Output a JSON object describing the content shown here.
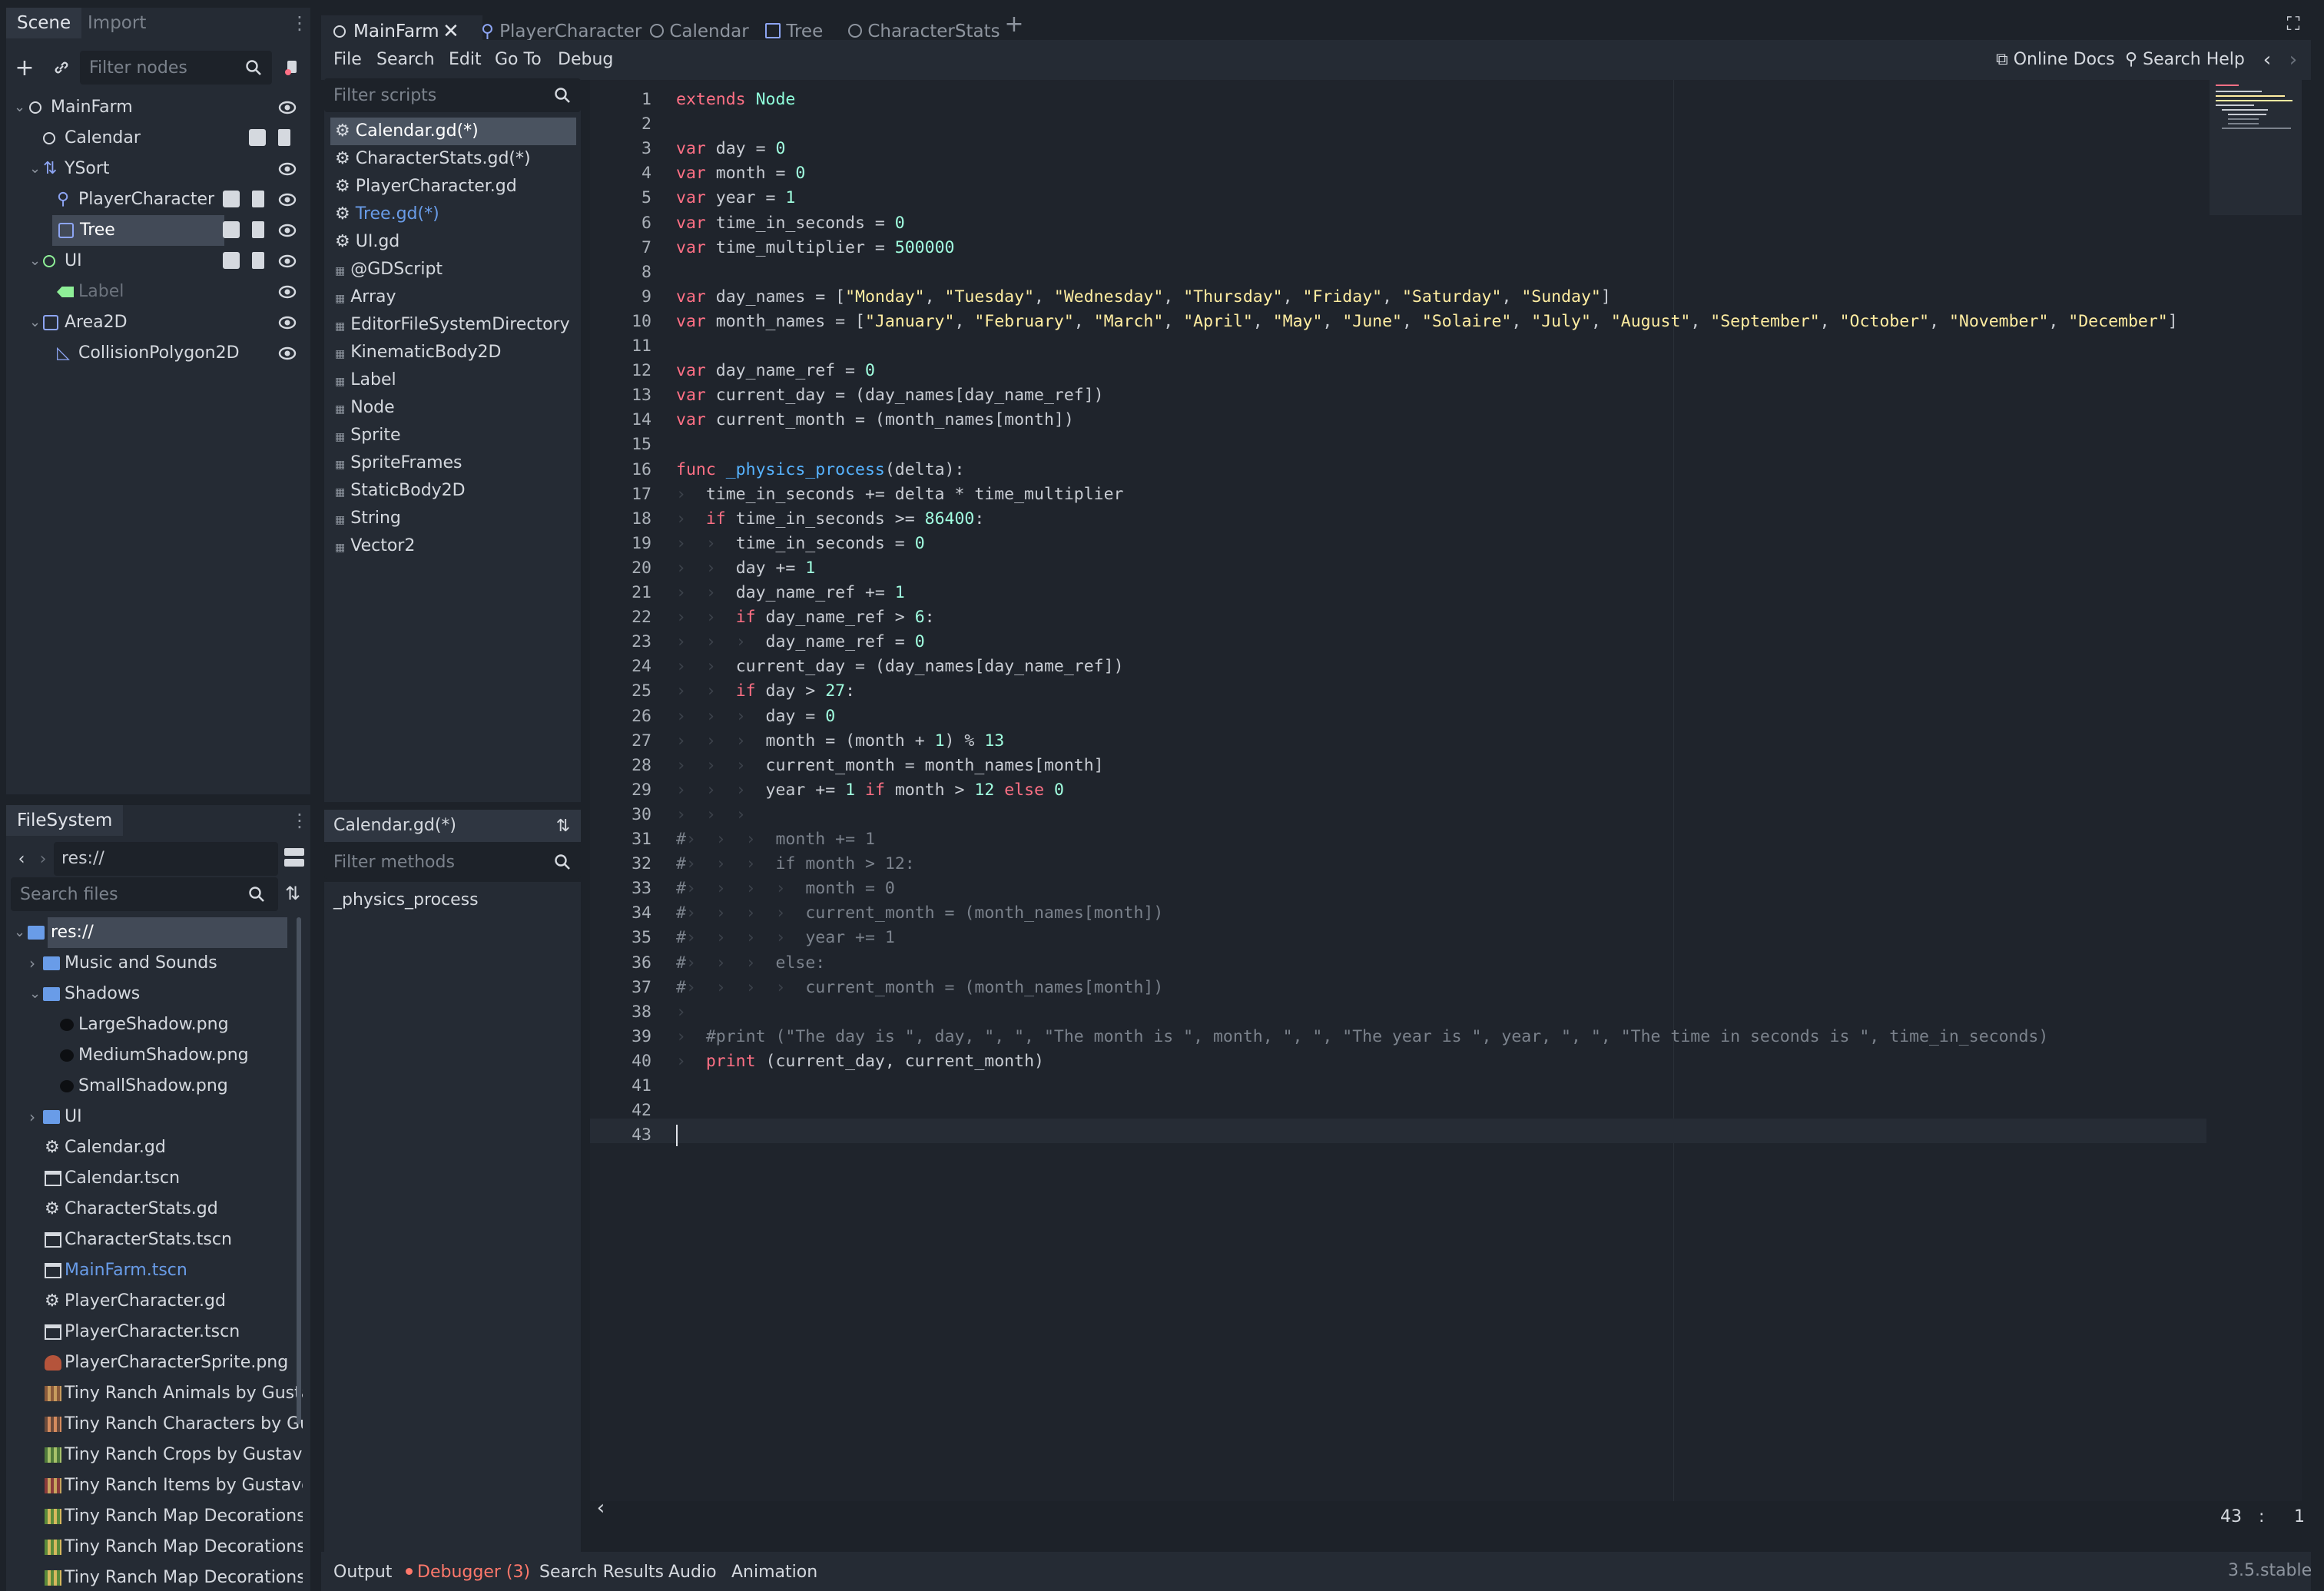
{
  "scene_dock": {
    "tabs": [
      "Scene",
      "Import"
    ],
    "filter_placeholder": "Filter nodes",
    "tree": [
      {
        "label": "MainFarm",
        "icon": "node-circle-icon"
      },
      {
        "label": "Calendar",
        "icon": "node-circle-icon"
      },
      {
        "label": "YSort",
        "icon": "ysort-icon"
      },
      {
        "label": "PlayerCharacter",
        "icon": "kinematic-body-icon"
      },
      {
        "label": "Tree",
        "icon": "static-body-icon"
      },
      {
        "label": "UI",
        "icon": "node-circle-icon"
      },
      {
        "label": "Label",
        "icon": "label-icon"
      },
      {
        "label": "Area2D",
        "icon": "area2d-icon"
      },
      {
        "label": "CollisionPolygon2D",
        "icon": "collision-polygon-icon"
      }
    ]
  },
  "filesystem_dock": {
    "title": "FileSystem",
    "path": "res://",
    "search_placeholder": "Search files",
    "items": [
      {
        "label": "res://",
        "icon": "folder-icon"
      },
      {
        "label": "Music and Sounds",
        "icon": "folder-icon"
      },
      {
        "label": "Shadows",
        "icon": "folder-icon"
      },
      {
        "label": "LargeShadow.png",
        "icon": "image-icon"
      },
      {
        "label": "MediumShadow.png",
        "icon": "image-icon"
      },
      {
        "label": "SmallShadow.png",
        "icon": "image-icon"
      },
      {
        "label": "UI",
        "icon": "folder-icon"
      },
      {
        "label": "Calendar.gd",
        "icon": "gear-icon"
      },
      {
        "label": "Calendar.tscn",
        "icon": "scene-icon"
      },
      {
        "label": "CharacterStats.gd",
        "icon": "gear-icon"
      },
      {
        "label": "CharacterStats.tscn",
        "icon": "scene-icon"
      },
      {
        "label": "MainFarm.tscn",
        "icon": "scene-icon"
      },
      {
        "label": "PlayerCharacter.gd",
        "icon": "gear-icon"
      },
      {
        "label": "PlayerCharacter.tscn",
        "icon": "scene-icon"
      },
      {
        "label": "PlayerCharacterSprite.png",
        "icon": "image-icon"
      },
      {
        "label": "Tiny Ranch Animals by Gusta",
        "icon": "image-icon"
      },
      {
        "label": "Tiny Ranch Characters by Gu",
        "icon": "image-icon"
      },
      {
        "label": "Tiny Ranch Crops by Gustavo",
        "icon": "image-icon"
      },
      {
        "label": "Tiny Ranch Items by Gustavo",
        "icon": "image-icon"
      },
      {
        "label": "Tiny Ranch Map Decorations",
        "icon": "image-icon"
      },
      {
        "label": "Tiny Ranch Map Decorations",
        "icon": "image-icon"
      },
      {
        "label": "Tiny Ranch Map Decorations",
        "icon": "image-icon"
      }
    ]
  },
  "top_tabs": [
    {
      "label": "MainFarm",
      "icon": "node-circle-icon"
    },
    {
      "label": "PlayerCharacter",
      "icon": "kinematic-body-icon"
    },
    {
      "label": "Calendar",
      "icon": "node-circle-icon"
    },
    {
      "label": "Tree",
      "icon": "static-body-icon"
    },
    {
      "label": "CharacterStats",
      "icon": "node-circle-icon"
    }
  ],
  "menu": [
    "File",
    "Search",
    "Edit",
    "Go To",
    "Debug"
  ],
  "help": {
    "online_docs": "Online Docs",
    "search_help": "Search Help"
  },
  "scripts_panel": {
    "filter_placeholder": "Filter scripts",
    "scripts": [
      {
        "label": "Calendar.gd(*)",
        "icon": "gear-icon"
      },
      {
        "label": "CharacterStats.gd(*)",
        "icon": "gear-icon"
      },
      {
        "label": "PlayerCharacter.gd",
        "icon": "gear-icon"
      },
      {
        "label": "Tree.gd(*)",
        "icon": "gear-icon"
      },
      {
        "label": "UI.gd",
        "icon": "gear-icon"
      },
      {
        "label": "@GDScript",
        "icon": "doc-icon"
      },
      {
        "label": "Array",
        "icon": "doc-icon"
      },
      {
        "label": "EditorFileSystemDirectory",
        "icon": "doc-icon"
      },
      {
        "label": "KinematicBody2D",
        "icon": "doc-icon"
      },
      {
        "label": "Label",
        "icon": "doc-icon"
      },
      {
        "label": "Node",
        "icon": "doc-icon"
      },
      {
        "label": "Sprite",
        "icon": "doc-icon"
      },
      {
        "label": "SpriteFrames",
        "icon": "doc-icon"
      },
      {
        "label": "StaticBody2D",
        "icon": "doc-icon"
      },
      {
        "label": "String",
        "icon": "doc-icon"
      },
      {
        "label": "Vector2",
        "icon": "doc-icon"
      }
    ],
    "current_script": "Calendar.gd(*)",
    "methods_placeholder": "Filter methods",
    "methods": [
      "_physics_process"
    ]
  },
  "code_lines": [
    "extends Node",
    "",
    "var day = 0",
    "var month = 0",
    "var year = 1",
    "var time_in_seconds = 0",
    "var time_multiplier = 500000",
    "",
    "var day_names = [\"Monday\", \"Tuesday\", \"Wednesday\", \"Thursday\", \"Friday\", \"Saturday\", \"Sunday\"]",
    "var month_names = [\"January\", \"February\", \"March\", \"April\", \"May\", \"June\", \"Solaire\", \"July\", \"August\", \"September\", \"October\", \"November\", \"December\"]",
    "",
    "var day_name_ref = 0",
    "var current_day = (day_names[day_name_ref])",
    "var current_month = (month_names[month])",
    "",
    "func _physics_process(delta):",
    "\ttime_in_seconds += delta * time_multiplier",
    "\tif time_in_seconds >= 86400:",
    "\t\ttime_in_seconds = 0",
    "\t\tday += 1",
    "\t\tday_name_ref += 1",
    "\t\tif day_name_ref > 6:",
    "\t\t\tday_name_ref = 0",
    "\t\tcurrent_day = (day_names[day_name_ref])",
    "\t\tif day > 27:",
    "\t\t\tday = 0",
    "\t\t\tmonth = (month + 1) % 13",
    "\t\t\tcurrent_month = month_names[month]",
    "\t\t\tyear += 1 if month > 12 else 0",
    "\t\t\t",
    "#\t\t\tmonth += 1",
    "#\t\t\tif month > 12:",
    "#\t\t\t\tmonth = 0",
    "#\t\t\t\tcurrent_month = (month_names[month])",
    "#\t\t\t\tyear += 1",
    "#\t\t\telse:",
    "#\t\t\t\tcurrent_month = (month_names[month])",
    "\t",
    "\t#print (\"The day is \", day, \", \", \"The month is \", month, \", \", \"The year is \", year, \", \", \"The time in seconds is \", time_in_seconds)",
    "\tprint (current_day, current_month)",
    "",
    "",
    ""
  ],
  "status": {
    "line": "43",
    "sep": ":",
    "col": "1"
  },
  "bottom_panel": {
    "tabs": [
      "Output",
      "Debugger (3)",
      "Search Results",
      "Audio",
      "Animation"
    ],
    "version": "3.5.stable"
  },
  "colors": {
    "background": "#1d2229",
    "panel": "#252b34",
    "editor_bg": "#1f242c",
    "keyword": "#ff7085",
    "string": "#ffeda1",
    "number": "#a1ffe0",
    "function": "#57b3ff",
    "type": "#8fffdb",
    "comment": "#7b828c",
    "debugger_alert": "#ff786b",
    "accent": "#699ce8"
  }
}
